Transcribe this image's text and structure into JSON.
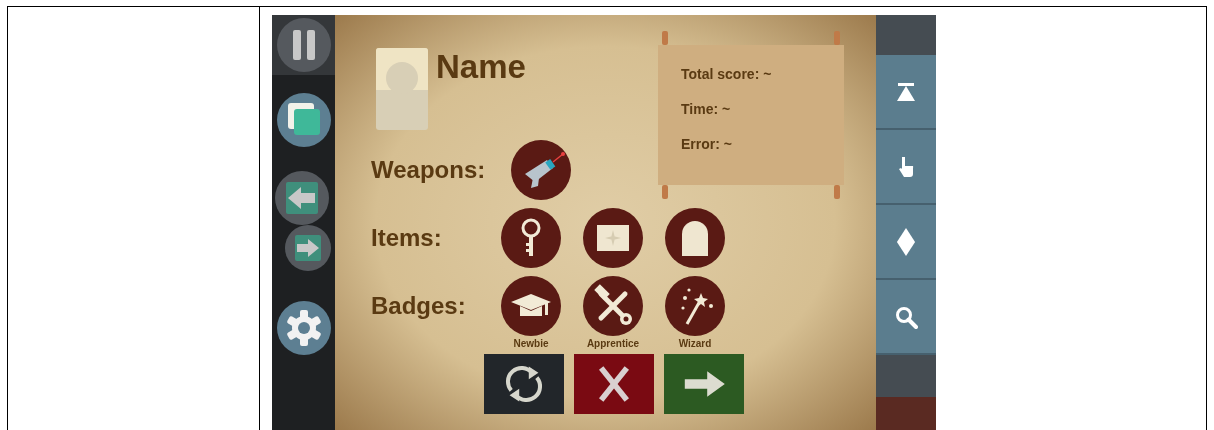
{
  "profile": {
    "name": "Name"
  },
  "stats": [
    "Total score: ~",
    "Time: ~",
    "Error: ~"
  ],
  "rows": [
    {
      "label": "Weapons:"
    },
    {
      "label": "Items:"
    },
    {
      "label": "Badges:",
      "captions": [
        "Newbie",
        "Apprentice",
        "Wizard"
      ]
    }
  ]
}
